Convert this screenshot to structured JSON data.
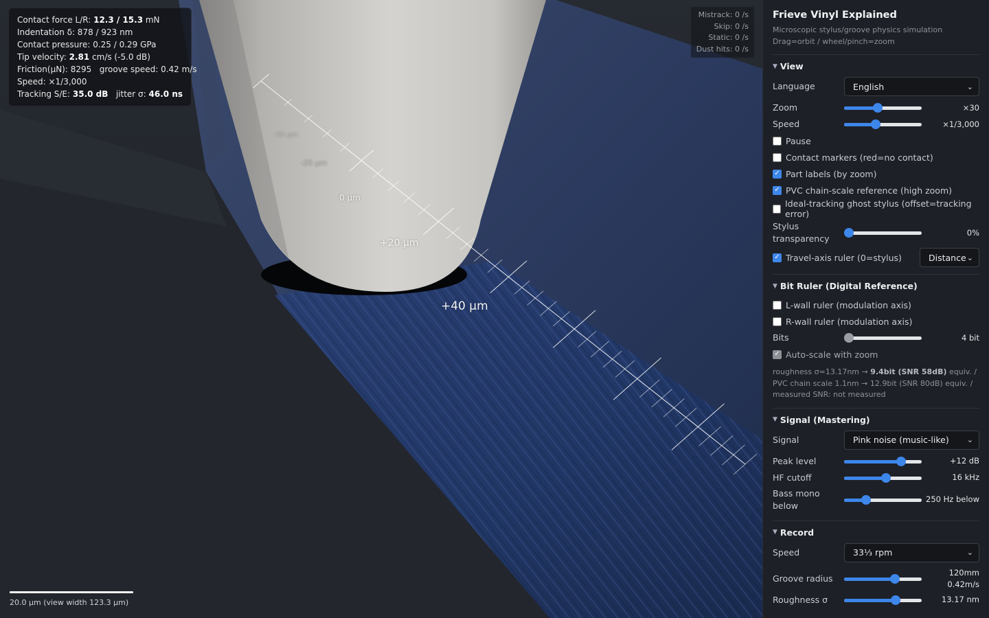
{
  "stats": {
    "contact_force_label": "Contact force L/R: ",
    "contact_force_value": "12.3 / 15.3",
    "contact_force_unit": " mN",
    "indentation": "Indentation δ: 878 / 923 nm",
    "contact_pressure": "Contact pressure: 0.25 / 0.29 GPa",
    "tip_velocity_label": "Tip velocity: ",
    "tip_velocity_value": "2.81",
    "tip_velocity_rest": " cm/s (-5.0 dB)",
    "friction": "Friction(μN): 8295   groove speed: 0.42 m/s",
    "speed": "Speed: ×1/3,000",
    "tracking_label": "Tracking S/E: ",
    "tracking_value": "35.0 dB",
    "jitter_label": "   jitter σ: ",
    "jitter_value": "46.0 ns"
  },
  "events": {
    "mistrack": "Mistrack: 0 /s",
    "skip": "Skip: 0 /s",
    "static": "Static: 0 /s",
    "dust": "Dust hits: 0 /s"
  },
  "ruler_labels": {
    "m40": "-40 μm",
    "m20": "-20 μm",
    "zero": "0 μm",
    "p20": "+20 μm",
    "p40": "+40 μm"
  },
  "scalebar": {
    "text": "20.0 μm (view width 123.3 μm)"
  },
  "panel": {
    "title": "Frieve Vinyl Explained",
    "subtitle1": "Microscopic stylus/groove physics simulation",
    "subtitle2": "Drag=orbit / wheel/pinch=zoom",
    "view": {
      "header": "View",
      "language_label": "Language",
      "language_value": "English",
      "zoom_label": "Zoom",
      "zoom_value": "×30",
      "zoom_level": 0.42,
      "speed_label": "Speed",
      "speed_value": "×1/3,000",
      "speed_level": 0.39,
      "pause": "Pause",
      "contact_markers": "Contact markers (red=no contact)",
      "part_labels": "Part labels (by zoom)",
      "pvc_reference": "PVC chain-scale reference (high zoom)",
      "ghost_stylus": "Ideal-tracking ghost stylus (offset=tracking error)",
      "transparency_label": "Stylus transparency",
      "transparency_value": "0%",
      "transparency_level": 0.0,
      "travel_ruler": "Travel-axis ruler (0=stylus)",
      "travel_mode": "Distance"
    },
    "bit_ruler": {
      "header": "Bit Ruler (Digital Reference)",
      "l_wall": "L-wall ruler (modulation axis)",
      "r_wall": "R-wall ruler (modulation axis)",
      "bits_label": "Bits",
      "bits_value": "4 bit",
      "bits_level": 0.0,
      "auto_scale": "Auto-scale with zoom",
      "note_a": "roughness σ=13.17nm → ",
      "note_b": "9.4bit (SNR 58dB)",
      "note_c": " equiv. / PVC chain scale 1.1nm → 12.9bit (SNR 80dB) equiv. / measured SNR: not measured"
    },
    "signal": {
      "header": "Signal (Mastering)",
      "signal_label": "Signal",
      "signal_value": "Pink noise (music-like)",
      "peak_label": "Peak level",
      "peak_value": "+12 dB",
      "peak_level": 0.77,
      "hf_label": "HF cutoff",
      "hf_value": "16 kHz",
      "hf_level": 0.55,
      "bass_label": "Bass mono below",
      "bass_value": "250 Hz below",
      "bass_level": 0.25
    },
    "record": {
      "header": "Record",
      "speed_label": "Speed",
      "speed_value": "33⅓ rpm",
      "radius_label": "Groove radius",
      "radius_value1": "120mm",
      "radius_value2": "0.42m/s",
      "radius_level": 0.68,
      "roughness_label": "Roughness σ",
      "roughness_value": "13.17 nm",
      "roughness_level": 0.69
    }
  }
}
